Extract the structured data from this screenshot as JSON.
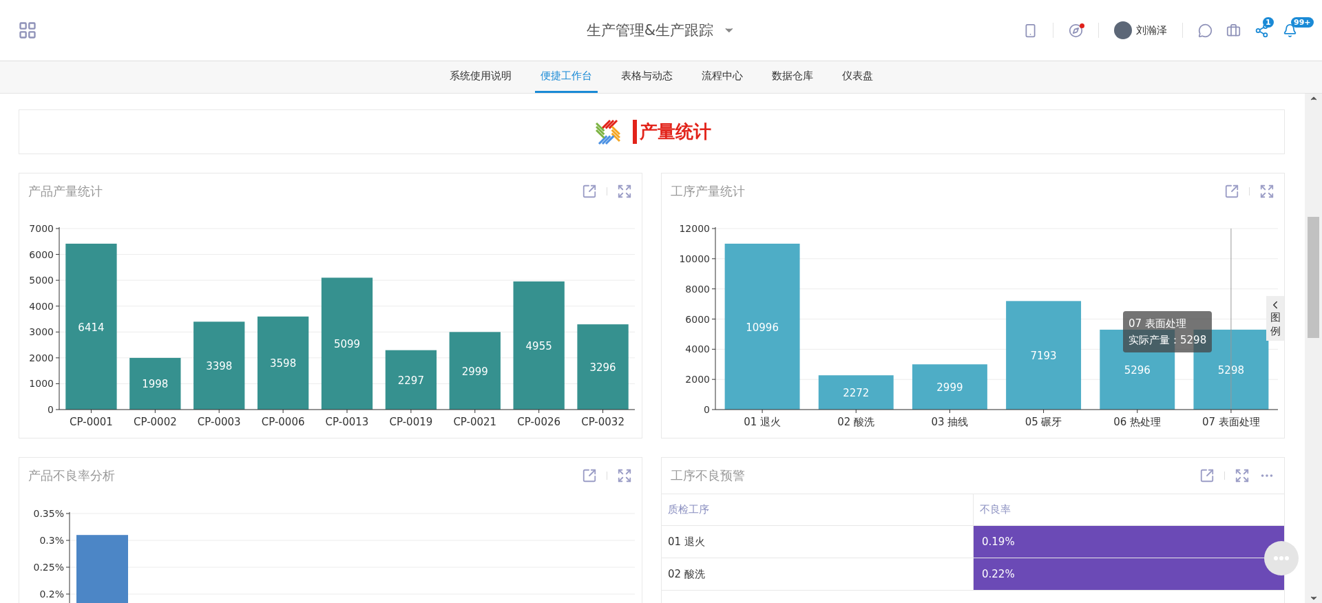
{
  "header": {
    "title": "生产管理&生产跟踪",
    "user_name": "刘瀚泽",
    "icons_left": [
      {
        "kind": "phone",
        "alert": false
      },
      {
        "kind": "compass",
        "alert": true
      }
    ],
    "icons_right": [
      {
        "kind": "chat"
      },
      {
        "kind": "briefcase"
      },
      {
        "kind": "share",
        "badge": "1"
      },
      {
        "kind": "bell",
        "badge": "99+"
      }
    ]
  },
  "nav": {
    "tabs": [
      {
        "label": "系统使用说明",
        "selected": false
      },
      {
        "label": "便捷工作台",
        "selected": true
      },
      {
        "label": "表格与动态",
        "selected": false
      },
      {
        "label": "流程中心",
        "selected": false
      },
      {
        "label": "数据仓库",
        "selected": false
      },
      {
        "label": "仪表盘",
        "selected": false
      }
    ]
  },
  "banner": {
    "title": "产量统计"
  },
  "panels": [
    {
      "kind": "chart",
      "title": "产品产量统计",
      "menu": false,
      "chart_data": {
        "type": "bar",
        "categories": [
          "CP-0001",
          "CP-0002",
          "CP-0003",
          "CP-0006",
          "CP-0013",
          "CP-0019",
          "CP-0021",
          "CP-0026",
          "CP-0032"
        ],
        "values": [
          6414,
          1998,
          3398,
          3598,
          5099,
          2297,
          2999,
          4955,
          3296
        ],
        "ylim": [
          0,
          7000
        ],
        "yticks": [
          0,
          1000,
          2000,
          3000,
          4000,
          5000,
          6000,
          7000
        ],
        "data_labels": true,
        "grid": true,
        "color": "#36918f"
      }
    },
    {
      "kind": "chart",
      "title": "工序产量统计",
      "menu": false,
      "legend_toggle": "图例",
      "tooltip": {
        "title": "07 表面处理",
        "text": "实际产量：5298"
      },
      "chart_data": {
        "type": "bar",
        "categories": [
          "01 退火",
          "02 酸洗",
          "03 抽线",
          "05 碾牙",
          "06 热处理",
          "07 表面处理"
        ],
        "values": [
          10996,
          2272,
          2999,
          7193,
          5296,
          5298
        ],
        "ylim": [
          0,
          12000
        ],
        "yticks": [
          0,
          2000,
          4000,
          6000,
          8000,
          10000,
          12000
        ],
        "data_labels": true,
        "grid": true,
        "color": "#4eadc6",
        "ref_lines": [
          {
            "axis": "x",
            "value": "07 表面处理"
          }
        ]
      }
    },
    {
      "kind": "chart",
      "title": "产品不良率分析",
      "menu": false,
      "chart_data": {
        "type": "bar",
        "values": [
          0.31
        ],
        "ylim": [
          0,
          0.35
        ],
        "yticks": [
          {
            "value": 0.2,
            "label": "0.2%"
          },
          {
            "value": 0.25,
            "label": "0.25%"
          },
          {
            "value": 0.3,
            "label": "0.3%"
          },
          {
            "value": 0.35,
            "label": "0.35%"
          }
        ],
        "grid": true,
        "color": "#4c86c6"
      }
    },
    {
      "kind": "table",
      "title": "工序不良预警",
      "menu": true,
      "columns": [
        "质检工序",
        "不良率"
      ],
      "rows": [
        {
          "process": "01 退火",
          "rate": "0.19%",
          "color": "#6b4ab6"
        },
        {
          "process": "02 酸洗",
          "rate": "0.22%",
          "color": "#6b4ab6"
        }
      ]
    }
  ]
}
